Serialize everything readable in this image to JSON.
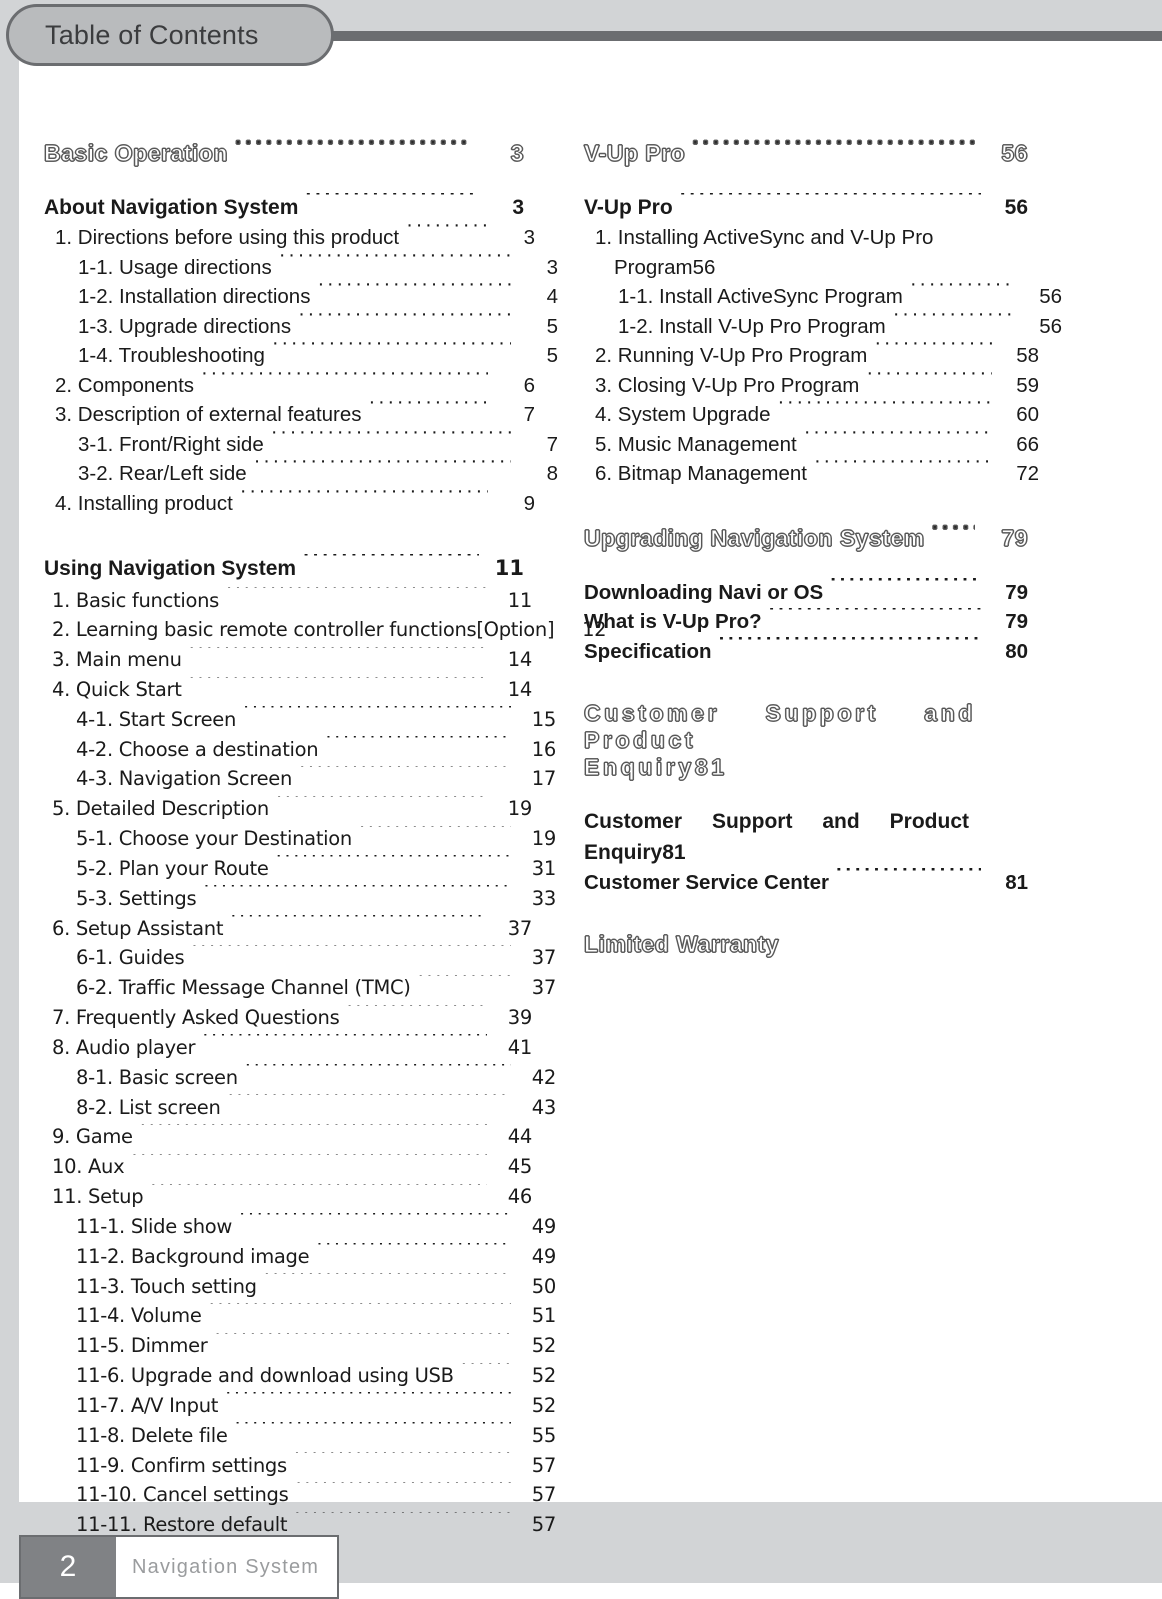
{
  "page": {
    "tab_label": "Table of Contents",
    "footer_page_number": "2",
    "footer_product": "Navigation System"
  },
  "left_column": {
    "section1": {
      "title": "Basic Operation",
      "page": "3",
      "group_title": "About Navigation System",
      "group_page": "3",
      "entries": [
        {
          "label": "1. Directions before using this product",
          "page": "3",
          "level": 1
        },
        {
          "label": "1-1. Usage directions",
          "page": "3",
          "level": 2
        },
        {
          "label": "1-2. Installation directions",
          "page": "4",
          "level": 2
        },
        {
          "label": "1-3. Upgrade directions",
          "page": "5",
          "level": 2
        },
        {
          "label": "1-4. Troubleshooting",
          "page": "5",
          "level": 2
        },
        {
          "label": "2. Components",
          "page": "6",
          "level": 1
        },
        {
          "label": "3. Description of external features",
          "page": "7",
          "level": 1
        },
        {
          "label": "3-1. Front/Right side",
          "page": "7",
          "level": 2
        },
        {
          "label": "3-2. Rear/Left side",
          "page": "8",
          "level": 2
        },
        {
          "label": "4. Installing product",
          "page": "9",
          "level": 1
        }
      ]
    },
    "section2": {
      "group_title": "Using Navigation System",
      "group_page": "11",
      "entries": [
        {
          "label": "1. Basic functions",
          "page": "11",
          "level": 1
        },
        {
          "label": "2. Learning basic remote controller functions[Option]",
          "page": "12",
          "level": 1,
          "noleader": true
        },
        {
          "label": "3. Main menu",
          "page": "14",
          "level": 1
        },
        {
          "label": "4. Quick Start",
          "page": "14",
          "level": 1
        },
        {
          "label": "4-1. Start Screen",
          "page": "15",
          "level": 2
        },
        {
          "label": "4-2. Choose a destination",
          "page": "16",
          "level": 2
        },
        {
          "label": "4-3. Navigation Screen",
          "page": "17",
          "level": 2
        },
        {
          "label": "5. Detailed Description",
          "page": "19",
          "level": 1
        },
        {
          "label": "5-1. Choose your Destination",
          "page": "19",
          "level": 2
        },
        {
          "label": "5-2. Plan your Route",
          "page": "31",
          "level": 2
        },
        {
          "label": "5-3. Settings",
          "page": "33",
          "level": 2
        },
        {
          "label": "6. Setup Assistant",
          "page": "37",
          "level": 1
        },
        {
          "label": "6-1. Guides",
          "page": "37",
          "level": 2
        },
        {
          "label": "6-2. Traffic Message Channel (TMC)",
          "page": "37",
          "level": 2
        },
        {
          "label": "7. Frequently Asked Questions",
          "page": "39",
          "level": 1
        },
        {
          "label": "8. Audio player",
          "page": "41",
          "level": 1
        },
        {
          "label": "8-1. Basic screen",
          "page": "42",
          "level": 2
        },
        {
          "label": "8-2. List screen",
          "page": "43",
          "level": 2
        },
        {
          "label": "9. Game",
          "page": "44",
          "level": 1
        },
        {
          "label": "10. Aux",
          "page": "45",
          "level": 1
        },
        {
          "label": "11. Setup",
          "page": "46",
          "level": 1
        },
        {
          "label": "11-1. Slide show",
          "page": "49",
          "level": 2
        },
        {
          "label": "11-2. Background image",
          "page": "49",
          "level": 2
        },
        {
          "label": "11-3. Touch setting",
          "page": "50",
          "level": 2
        },
        {
          "label": "11-4. Volume",
          "page": "51",
          "level": 2
        },
        {
          "label": "11-5. Dimmer",
          "page": "52",
          "level": 2
        },
        {
          "label": "11-6. Upgrade and download using USB",
          "page": "52",
          "level": 2
        },
        {
          "label": "11-7. A/V Input",
          "page": "52",
          "level": 2
        },
        {
          "label": "11-8. Delete file",
          "page": "55",
          "level": 2
        },
        {
          "label": "11-9. Confirm settings",
          "page": "57",
          "level": 2
        },
        {
          "label": "11-10. Cancel settings",
          "page": "57",
          "level": 2
        },
        {
          "label": "11-11. Restore default",
          "page": "57",
          "level": 2
        }
      ]
    }
  },
  "right_column": {
    "section1": {
      "title": "V-Up Pro",
      "page": "56",
      "group_title": "V-Up Pro",
      "group_page": "56",
      "entry1_line1": "1. Installing ActiveSync and V-Up Pro",
      "entry1_line2": "Program",
      "entry1_page": "56",
      "entries": [
        {
          "label": "1-1. Install ActiveSync Program",
          "page": "56",
          "level": 2
        },
        {
          "label": "1-2. Install V-Up Pro Program",
          "page": "56",
          "level": 2
        },
        {
          "label": "2. Running V-Up Pro Program",
          "page": "58",
          "level": 1
        },
        {
          "label": "3. Closing V-Up Pro Program",
          "page": "59",
          "level": 1
        },
        {
          "label": "4. System Upgrade",
          "page": "60",
          "level": 1
        },
        {
          "label": "5. Music Management",
          "page": "66",
          "level": 1
        },
        {
          "label": "6. Bitmap Management",
          "page": "72",
          "level": 1
        }
      ]
    },
    "section2": {
      "title": "Upgrading Navigation System",
      "page": "79",
      "entries": [
        {
          "label": "Downloading Navi or OS",
          "page": "79"
        },
        {
          "label": "What is V-Up Pro?",
          "page": "79"
        },
        {
          "label": "Specification",
          "page": "80"
        }
      ]
    },
    "section3": {
      "title_line1": "Customer Support and Product",
      "title_line2": "Enquiry",
      "page": "81",
      "head_line1": "Customer Support and Product",
      "head_line2": "Enquiry",
      "head_page": "81",
      "entries": [
        {
          "label": "Customer Service Center",
          "page": "81"
        }
      ]
    },
    "section4": {
      "title": "Limited Warranty"
    }
  }
}
